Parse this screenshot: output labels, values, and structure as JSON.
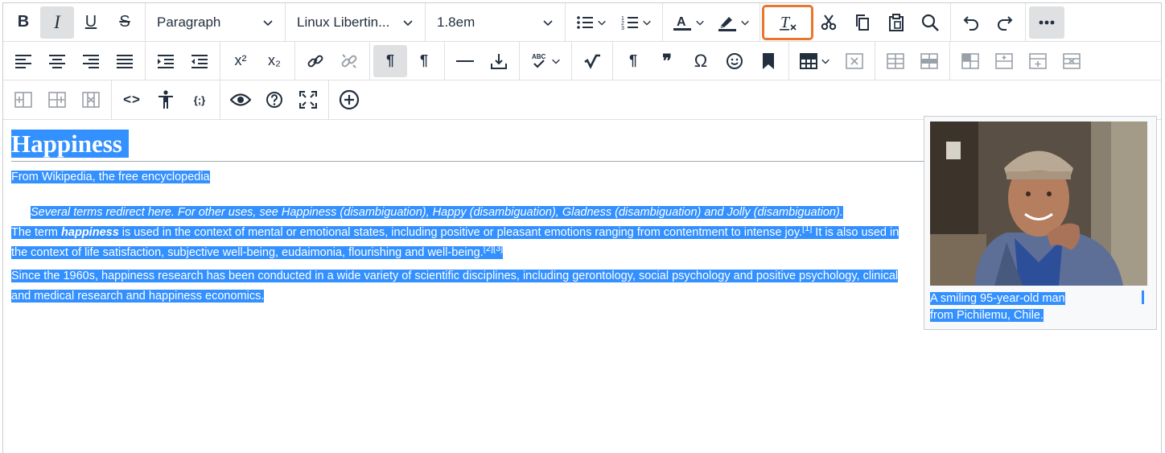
{
  "toolbar": {
    "block_format": "Paragraph",
    "font_family": "Linux Libertin...",
    "font_size": "1.8em",
    "bold_label": "B",
    "italic_label": "I",
    "underline_label": "U",
    "strike_label": "S",
    "superscript_label": "x²",
    "subscript_label": "x₂",
    "pilcrow_label": "¶",
    "quote_label": "❞",
    "omega_label": "Ω",
    "code_label": "<>",
    "template_label": "{;}"
  },
  "document": {
    "title": "Happiness",
    "subtitle": "From Wikipedia, the free encyclopedia",
    "hatnote": "Several terms redirect here. For other uses, see Happiness (disambiguation), Happy (disambiguation), Gladness (disambiguation) and Jolly (disambiguation).",
    "p1_before": "The term ",
    "p1_term": "happiness",
    "p1_mid": " is used in the context of mental or emotional states, including positive or pleasant emotions ranging from contentment to intense joy.",
    "p1_ref1": "[1]",
    "p1_after": " It is also used in the context of life satisfaction, subjective well-being, eudaimonia, flourishing and well-being.",
    "p1_ref23": "[2][3]",
    "p2": "Since the 1960s, happiness research has been conducted in a wide variety of scientific disciplines, including gerontology, social psychology and positive psychology, clinical and medical research and happiness economics.",
    "caption_line1": "A smiling 95-year-old man",
    "caption_line2": "from Pichilemu, Chile."
  },
  "colors": {
    "selection": "#3390ff",
    "highlight_outline": "#e8762c",
    "active_button": "#dee0e2"
  }
}
